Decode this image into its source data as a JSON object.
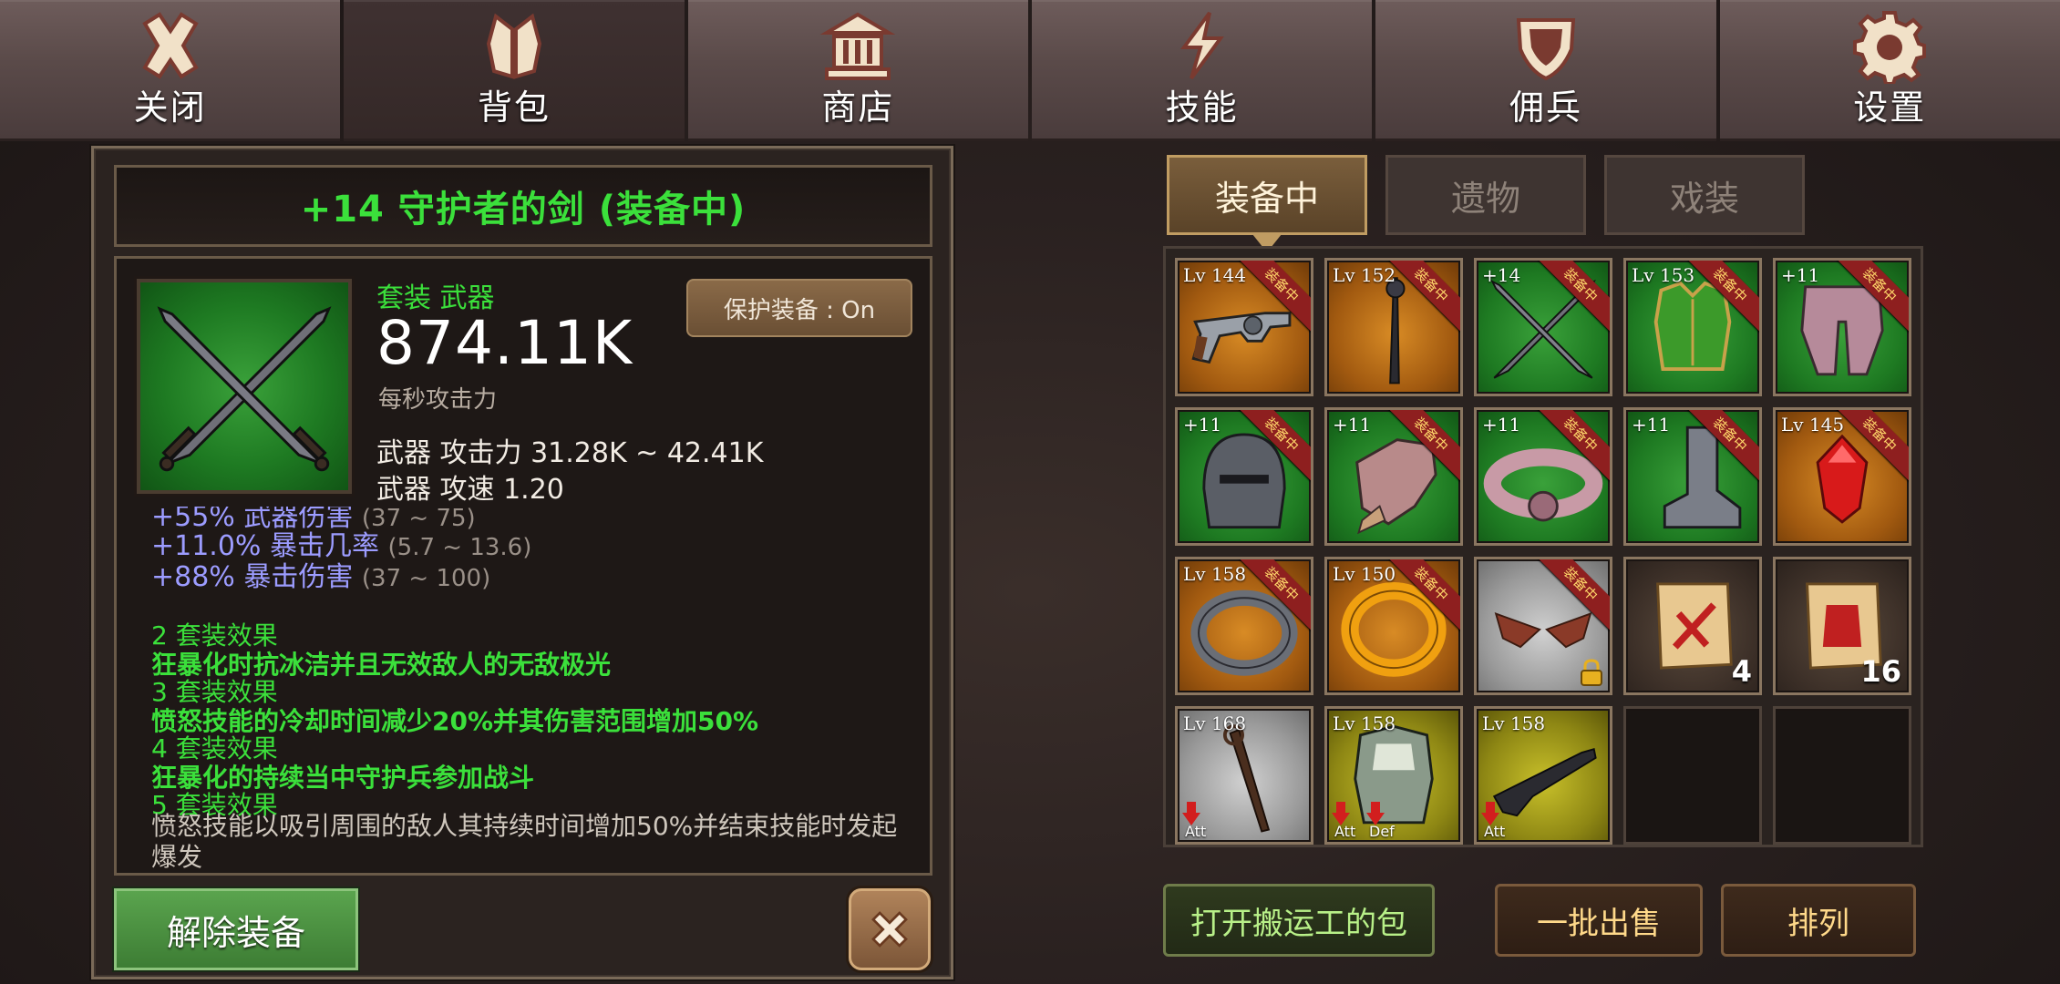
{
  "nav": {
    "tabs": [
      {
        "label": "关闭",
        "icon": "close-x-icon"
      },
      {
        "label": "背包",
        "icon": "backpack-icon",
        "active": true
      },
      {
        "label": "商店",
        "icon": "shop-temple-icon"
      },
      {
        "label": "技能",
        "icon": "lightning-icon"
      },
      {
        "label": "佣兵",
        "icon": "shield-icon"
      },
      {
        "label": "设置",
        "icon": "gear-icon"
      }
    ]
  },
  "detail": {
    "title": "+14 守护者的剑 (装备中)",
    "set_type": "套装 武器",
    "dps_value": "874.11K",
    "dps_label": "每秒攻击力",
    "protect_label": "保护装备 : On",
    "attack_line": "武器 攻击力 31.28K ~ 42.41K",
    "speed_line": "武器 攻速 1.20",
    "bonuses": [
      {
        "text": "+55% 武器伤害",
        "range": "(37 ~ 75)"
      },
      {
        "text": "+11.0% 暴击几率",
        "range": "(5.7 ~ 13.6)"
      },
      {
        "text": "+88% 暴击伤害",
        "range": "(37 ~ 100)"
      }
    ],
    "set_effects": [
      {
        "head": "2 套装效果",
        "desc": "狂暴化时抗冰洁并且无效敌人的无敌极光"
      },
      {
        "head": "3 套装效果",
        "desc": "愤怒技能的冷却时间减少20%并其伤害范围增加50%"
      },
      {
        "head": "4 套装效果",
        "desc": "狂暴化的持续当中守护兵参加战斗"
      },
      {
        "head": "5 套装效果",
        "desc": "愤怒技能以吸引周围的敌人其持续时间增加50%并结束技能时发起爆发"
      }
    ],
    "unequip_label": "解除装备"
  },
  "inventory": {
    "tabs": [
      {
        "label": "装备中",
        "active": true
      },
      {
        "label": "遗物"
      },
      {
        "label": "戏装"
      }
    ],
    "equipped_ribbon": "装备中",
    "slots": [
      {
        "lv": "Lv 144",
        "bg": "orange",
        "item": "revolver-icon",
        "equipped": true
      },
      {
        "lv": "Lv 152",
        "bg": "orange",
        "item": "staff-icon",
        "equipped": true
      },
      {
        "lv": "+14",
        "bg": "green",
        "item": "crossed-swords-icon",
        "equipped": true
      },
      {
        "lv": "Lv 153",
        "bg": "green",
        "item": "armor-icon",
        "equipped": true
      },
      {
        "lv": "+11",
        "bg": "green",
        "item": "leg-armor-icon",
        "equipped": true
      },
      {
        "lv": "+11",
        "bg": "green",
        "item": "helmet-icon",
        "equipped": true
      },
      {
        "lv": "+11",
        "bg": "green",
        "item": "gauntlet-icon",
        "equipped": true
      },
      {
        "lv": "+11",
        "bg": "green",
        "item": "belt-icon",
        "equipped": true
      },
      {
        "lv": "+11",
        "bg": "green",
        "item": "boot-icon",
        "equipped": true
      },
      {
        "lv": "Lv 145",
        "bg": "orange",
        "item": "red-gem-amulet-icon",
        "equipped": true
      },
      {
        "lv": "Lv 158",
        "bg": "orange",
        "item": "silver-ring-icon",
        "equipped": true
      },
      {
        "lv": "Lv 150",
        "bg": "orange",
        "item": "gold-ring-icon",
        "equipped": true
      },
      {
        "lv": "",
        "bg": "gray",
        "item": "wings-icon",
        "equipped": true,
        "locked": true
      },
      {
        "lv": "",
        "bg": "dark",
        "item": "scroll-sword-icon",
        "count": "4"
      },
      {
        "lv": "",
        "bg": "dark",
        "item": "scroll-armor-icon",
        "count": "16"
      },
      {
        "lv": "Lv 168",
        "bg": "gray",
        "item": "wand-icon",
        "downgrades": [
          "Att"
        ]
      },
      {
        "lv": "Lv 158",
        "bg": "yellow",
        "item": "chest-armor-icon",
        "downgrades": [
          "Att",
          "Def"
        ]
      },
      {
        "lv": "Lv 158",
        "bg": "yellow",
        "item": "shotgun-icon",
        "downgrades": [
          "Att"
        ]
      },
      {
        "lv": "",
        "bg": "empty",
        "item": "empty-slot"
      },
      {
        "lv": "",
        "bg": "empty",
        "item": "empty-slot"
      }
    ]
  },
  "buttons": {
    "open_porter": "打开搬运工的包",
    "bulk_sell": "一批出售",
    "sort": "排列"
  },
  "colors": {
    "set_green": "#3be03b",
    "bonus_purple": "#9c9cff",
    "equipped_ribbon": "#8e1f1f"
  }
}
